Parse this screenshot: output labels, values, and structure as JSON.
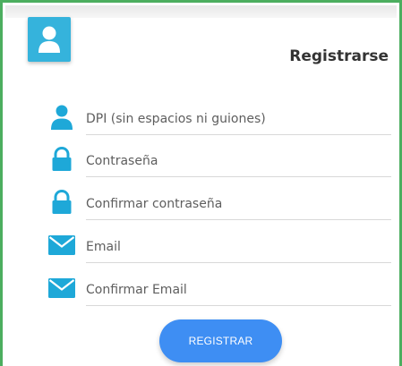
{
  "form": {
    "title": "Registrarse",
    "fields": [
      {
        "placeholder": "DPI (sin espacios ni guiones)",
        "icon": "user-icon"
      },
      {
        "placeholder": "Contraseña",
        "icon": "lock-icon"
      },
      {
        "placeholder": "Confirmar contraseña",
        "icon": "lock-icon"
      },
      {
        "placeholder": "Email",
        "icon": "envelope-icon"
      },
      {
        "placeholder": "Confirmar Email",
        "icon": "envelope-icon"
      }
    ],
    "submit_label": "REGISTRAR"
  },
  "colors": {
    "accent": "#35b3dc",
    "button": "#3e8ef3",
    "frame_border": "#4cae5f"
  }
}
